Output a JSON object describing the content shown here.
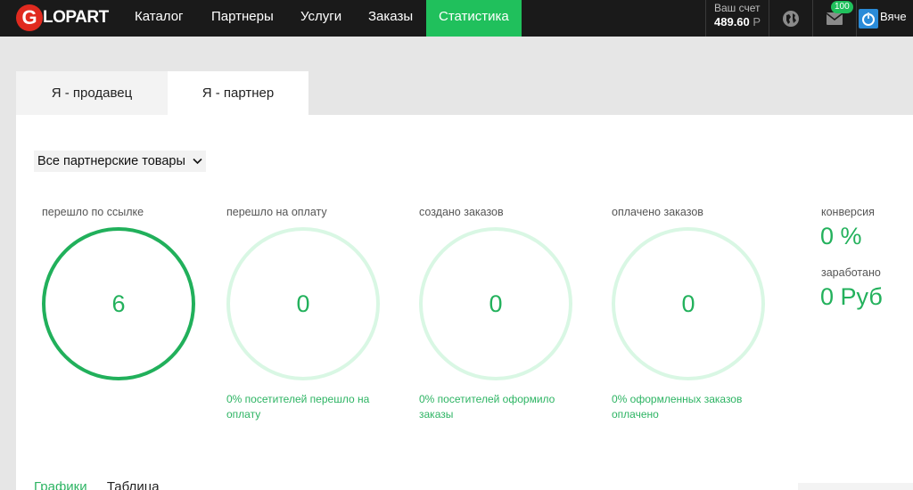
{
  "header": {
    "logo_letter": "G",
    "logo_text": "LOPART",
    "nav": [
      {
        "label": "Каталог"
      },
      {
        "label": "Партнеры"
      },
      {
        "label": "Услуги"
      },
      {
        "label": "Заказы"
      },
      {
        "label": "Статистика",
        "active": true
      }
    ],
    "account_label": "Ваш счет",
    "account_value": "489.60",
    "account_currency": "Р",
    "messages_badge": "100",
    "user_name": "Вяче"
  },
  "tabs": [
    {
      "label": "Я - продавец"
    },
    {
      "label": "Я - партнер",
      "active": true
    }
  ],
  "filter": {
    "selected": "Все партнерские товары"
  },
  "metrics": [
    {
      "label": "перешло по ссылке",
      "value": "6",
      "note": ""
    },
    {
      "label": "перешло на оплату",
      "value": "0",
      "note": "0% посетителей перешло на оплату"
    },
    {
      "label": "создано заказов",
      "value": "0",
      "note": "0% посетителей оформило заказы"
    },
    {
      "label": "оплачено заказов",
      "value": "0",
      "note": "0% оформленных заказов оплачено"
    }
  ],
  "summary": {
    "conversion_label": "конверсия",
    "conversion_value": "0 %",
    "earned_label": "заработано",
    "earned_value": "0 Руб"
  },
  "bottom_tabs": [
    {
      "label": "Графики"
    },
    {
      "label": "Таблица"
    }
  ],
  "colors": {
    "accent": "#20c05c",
    "topbar": "#1a1a1a",
    "logo_red": "#e02a1f"
  }
}
